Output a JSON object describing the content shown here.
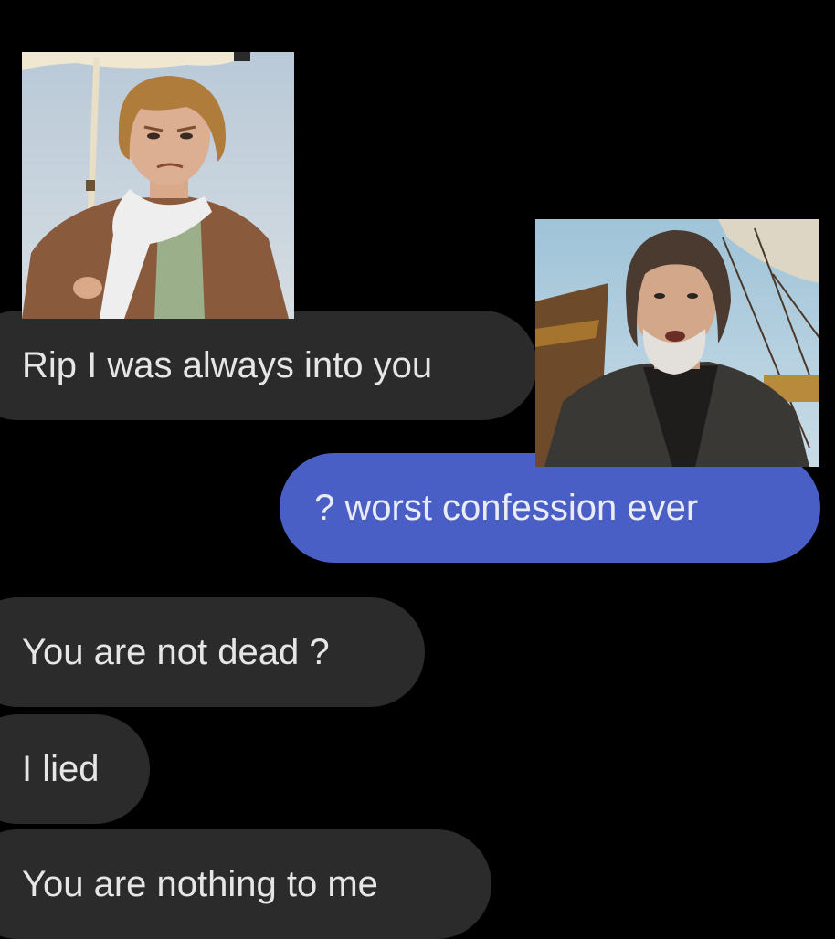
{
  "conversation": {
    "messages": [
      {
        "direction": "incoming",
        "text": "Rip I was always into you"
      },
      {
        "direction": "outgoing",
        "text": "? worst confession ever"
      },
      {
        "direction": "incoming",
        "text": "You are not dead ?"
      },
      {
        "direction": "incoming",
        "text": "I lied"
      },
      {
        "direction": "incoming",
        "text": "You are nothing to me"
      }
    ]
  },
  "colors": {
    "background": "#000000",
    "incoming_bubble": "#2b2b2c",
    "outgoing_bubble": "#4a5fc6",
    "text": "#e6e6e6"
  }
}
